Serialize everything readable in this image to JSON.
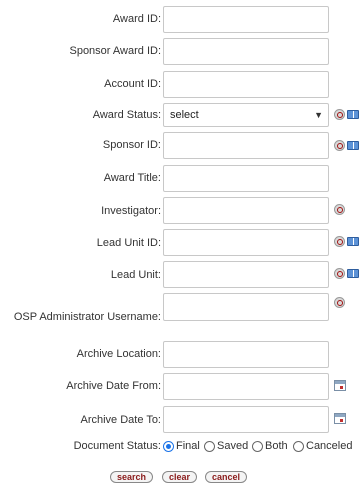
{
  "fields": [
    {
      "key": "award_id",
      "label": "Award ID:",
      "value": "",
      "type": "text"
    },
    {
      "key": "sponsor_award_id",
      "label": "Sponsor Award ID:",
      "value": "",
      "type": "text"
    },
    {
      "key": "account_id",
      "label": "Account ID:",
      "value": "",
      "type": "text"
    },
    {
      "key": "award_status",
      "label": "Award Status:",
      "value": "select",
      "type": "select"
    },
    {
      "key": "sponsor_id",
      "label": "Sponsor ID:",
      "value": "",
      "type": "text"
    },
    {
      "key": "award_title",
      "label": "Award Title:",
      "value": "",
      "type": "text"
    },
    {
      "key": "investigator",
      "label": "Investigator:",
      "value": "",
      "type": "text"
    },
    {
      "key": "lead_unit_id",
      "label": "Lead Unit ID:",
      "value": "",
      "type": "text"
    },
    {
      "key": "lead_unit",
      "label": "Lead Unit:",
      "value": "",
      "type": "text"
    },
    {
      "key": "osp_admin",
      "label": "OSP Administrator Username:",
      "value": "",
      "type": "text"
    },
    {
      "key": "archive_location",
      "label": "Archive Location:",
      "value": "",
      "type": "text"
    },
    {
      "key": "archive_date_from",
      "label": "Archive Date From:",
      "value": "",
      "type": "text"
    },
    {
      "key": "archive_date_to",
      "label": "Archive Date To:",
      "value": "",
      "type": "text"
    }
  ],
  "document_status": {
    "label": "Document Status:",
    "options": [
      "Final",
      "Saved",
      "Both",
      "Canceled"
    ],
    "selected": "Final"
  },
  "buttons": {
    "search": "search",
    "clear": "clear",
    "cancel": "cancel"
  },
  "icons": {
    "lookup": "search-icon",
    "direct_inquiry": "book-icon",
    "calendar": "calendar-icon"
  },
  "colors": {
    "radio_selected": "#1a73e8",
    "button_text": "#8a1a1a"
  }
}
